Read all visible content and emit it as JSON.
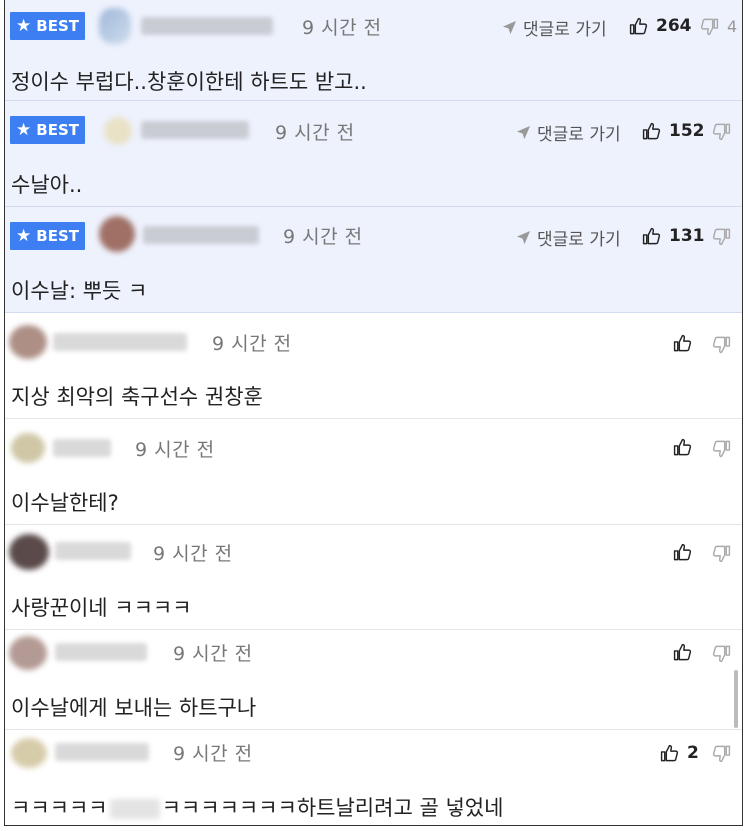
{
  "best_label": "BEST",
  "reply_label": "댓글로 가기",
  "comments": [
    {
      "best": true,
      "time": "9 시간 전",
      "likes": "264",
      "dislikes": "4",
      "text": "정이수 부럽다..창훈이한테 하트도 받고.."
    },
    {
      "best": true,
      "time": "9 시간 전",
      "likes": "152",
      "dislikes": "",
      "text": "수날아.."
    },
    {
      "best": true,
      "time": "9 시간 전",
      "likes": "131",
      "dislikes": "",
      "text": "이수날: 뿌듯 ㅋ"
    },
    {
      "best": false,
      "time": "9 시간 전",
      "likes": "",
      "dislikes": "",
      "text": "지상 최악의 축구선수 권창훈"
    },
    {
      "best": false,
      "time": "9 시간 전",
      "likes": "",
      "dislikes": "",
      "text": "이수날한테?"
    },
    {
      "best": false,
      "time": "9 시간 전",
      "likes": "",
      "dislikes": "",
      "text": "사랑꾼이네 ㅋㅋㅋㅋ"
    },
    {
      "best": false,
      "time": "9 시간 전",
      "likes": "",
      "dislikes": "",
      "text": "이수날에게 보내는 하트구나"
    },
    {
      "best": false,
      "time": "9 시간 전",
      "likes": "2",
      "dislikes": "",
      "text_a": "ㅋㅋㅋㅋㅋ",
      "text_b": "ㅋㅋㅋㅋㅋㅋㅋ하트날리려고 골 넣었네"
    }
  ],
  "icons": {
    "best_star": "star-icon",
    "reply": "send-arrow-icon",
    "like": "thumbs-up-icon",
    "dislike": "thumbs-down-icon"
  },
  "colors": {
    "best_badge": "#3d7ff2",
    "best_bg": "#eef2fd"
  }
}
